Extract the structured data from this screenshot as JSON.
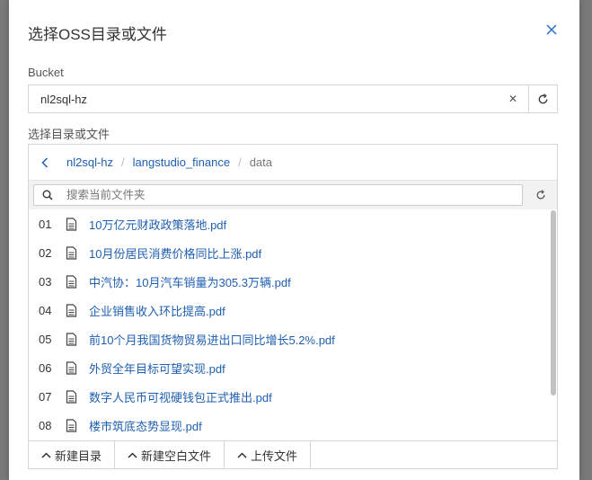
{
  "dialog": {
    "title": "选择OSS目录或文件"
  },
  "bucket": {
    "label": "Bucket",
    "value": "nl2sql-hz"
  },
  "browser": {
    "label": "选择目录或文件",
    "breadcrumb": [
      "nl2sql-hz",
      "langstudio_finance",
      "data"
    ],
    "search_placeholder": "搜索当前文件夹",
    "files": [
      {
        "index": "01",
        "name": "10万亿元财政政策落地.pdf"
      },
      {
        "index": "02",
        "name": "10月份居民消费价格同比上涨.pdf"
      },
      {
        "index": "03",
        "name": "中汽协：10月汽车销量为305.3万辆.pdf"
      },
      {
        "index": "04",
        "name": "企业销售收入环比提高.pdf"
      },
      {
        "index": "05",
        "name": "前10个月我国货物贸易进出口同比增长5.2%.pdf"
      },
      {
        "index": "06",
        "name": "外贸全年目标可望实现.pdf"
      },
      {
        "index": "07",
        "name": "数字人民币可视硬钱包正式推出.pdf"
      },
      {
        "index": "08",
        "name": "楼市筑底态势显现.pdf"
      }
    ],
    "actions": [
      "新建目录",
      "新建空白文件",
      "上传文件"
    ]
  },
  "colors": {
    "link": "#1f5fb0",
    "border": "#d6d6d6",
    "close_icon": "#2a6ac8"
  },
  "icons": {
    "close": "close-icon",
    "clear": "clear-icon",
    "refresh": "refresh-icon",
    "back": "chevron-left-icon",
    "search": "search-icon",
    "file": "file-icon",
    "action": "chevron-up-icon"
  }
}
